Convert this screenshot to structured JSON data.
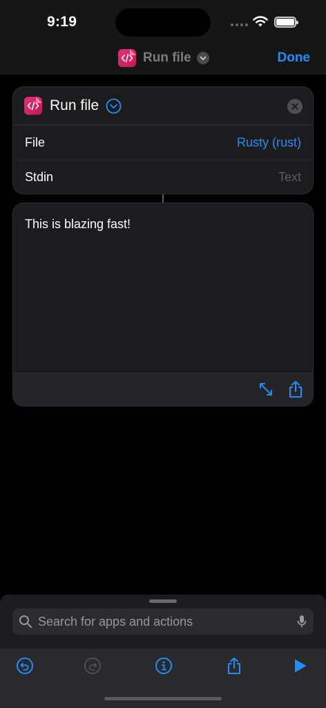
{
  "status_bar": {
    "time": "9:19"
  },
  "nav": {
    "title": "Run file",
    "done_label": "Done"
  },
  "action": {
    "title": "Run file",
    "params": [
      {
        "label": "File",
        "value": "Rusty (rust)"
      },
      {
        "label": "Stdin",
        "placeholder": "Text"
      }
    ]
  },
  "output": {
    "text": "This is blazing fast!"
  },
  "search": {
    "placeholder": "Search for apps and actions"
  },
  "icons": {
    "app": "code-file-icon",
    "chevron": "chevron-down-icon",
    "remove": "close-icon",
    "expand": "expand-arrows-icon",
    "share": "share-icon",
    "search": "search-icon",
    "mic": "microphone-icon",
    "undo": "undo-icon",
    "redo": "redo-icon",
    "info": "info-icon",
    "play": "play-icon"
  },
  "colors": {
    "accent": "#1f8fff",
    "app_icon": "#e3307d",
    "background": "#000000",
    "card": "#1c1c1e"
  }
}
